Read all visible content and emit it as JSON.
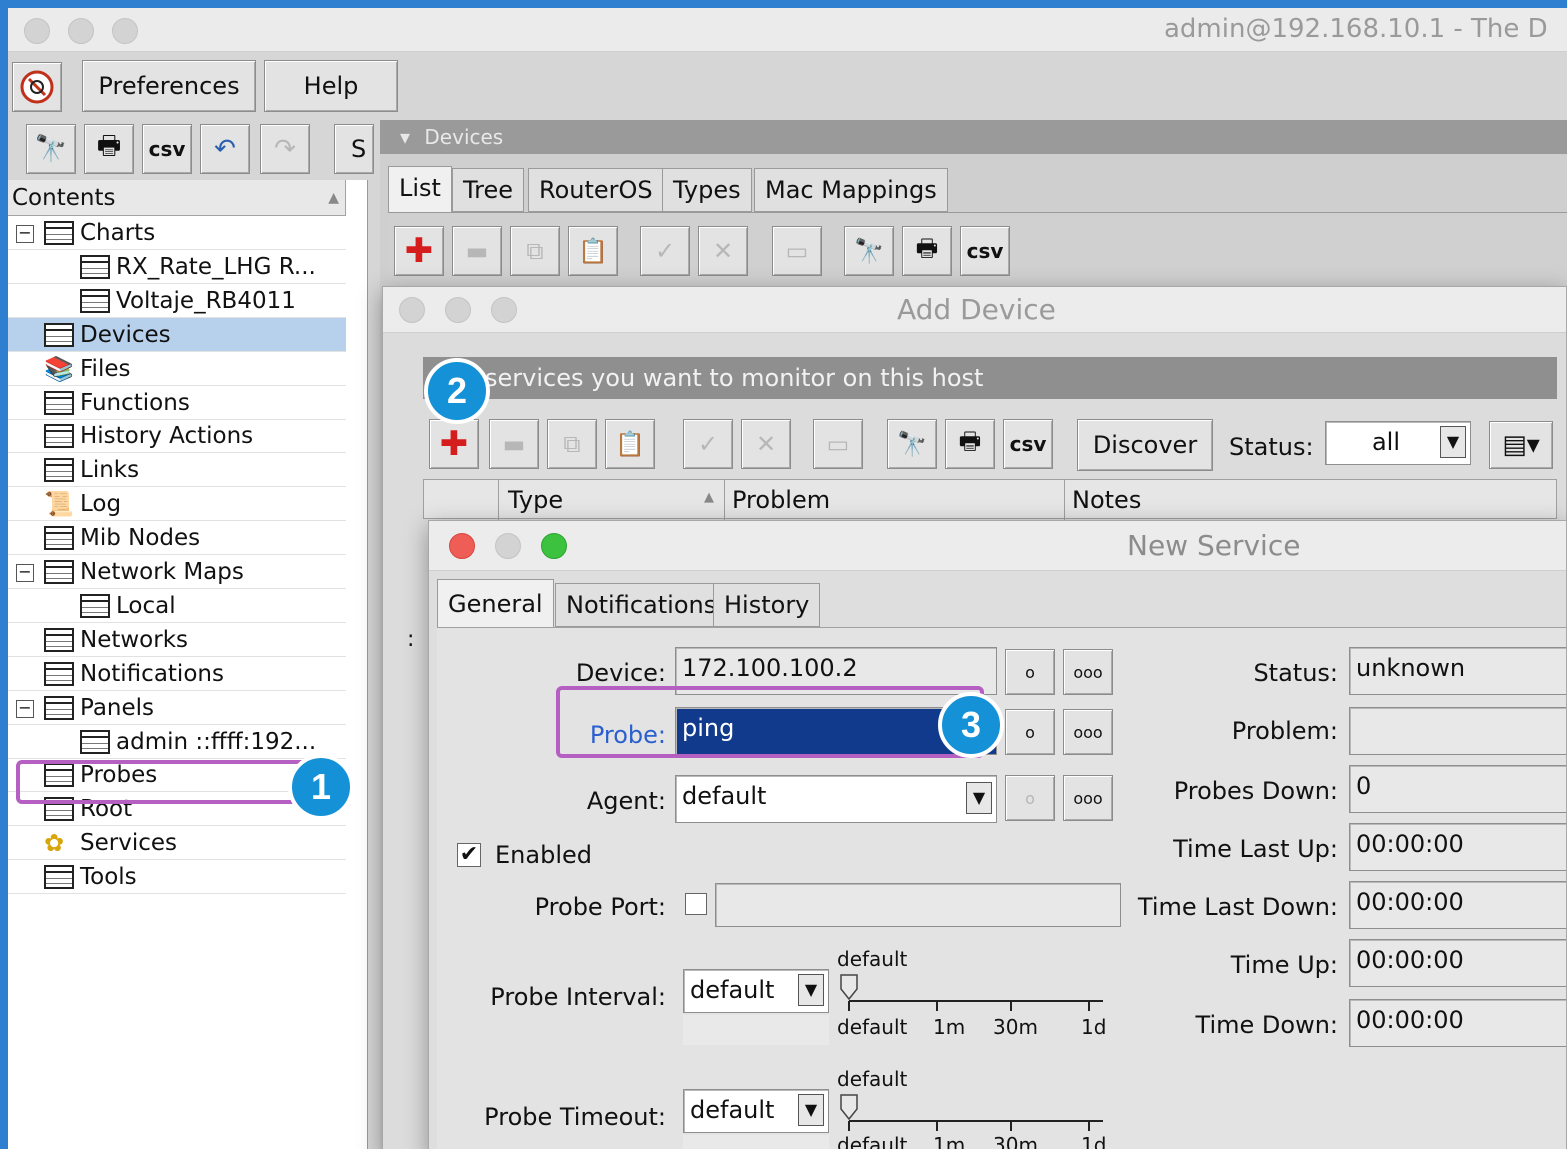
{
  "window": {
    "title": "admin@192.168.10.1 - The D"
  },
  "menu": {
    "preferences": "Preferences",
    "help": "Help"
  },
  "toolbar": {
    "csv": "csv",
    "s_partial": "S"
  },
  "sidebar": {
    "header": "Contents",
    "items": [
      {
        "label": "Charts"
      },
      {
        "label": "RX_Rate_LHG R..."
      },
      {
        "label": "Voltaje_RB4011"
      },
      {
        "label": "Devices"
      },
      {
        "label": "Files"
      },
      {
        "label": "Functions"
      },
      {
        "label": "History Actions"
      },
      {
        "label": "Links"
      },
      {
        "label": "Log"
      },
      {
        "label": "Mib Nodes"
      },
      {
        "label": "Network Maps"
      },
      {
        "label": "Local"
      },
      {
        "label": "Networks"
      },
      {
        "label": "Notifications"
      },
      {
        "label": "Panels"
      },
      {
        "label": "admin ::ffff:192..."
      },
      {
        "label": "Probes"
      },
      {
        "label": "Root"
      },
      {
        "label": "Services"
      },
      {
        "label": "Tools"
      }
    ]
  },
  "devices_panel": {
    "title": "Devices",
    "tabs": [
      "List",
      "Tree",
      "RouterOS",
      "Types",
      "Mac Mappings"
    ],
    "csv": "csv"
  },
  "add_device": {
    "title": "Add Device",
    "banner": "services you want to monitor on this host",
    "discover": "Discover",
    "status_label": "Status:",
    "status_value": "all",
    "csv": "csv",
    "columns": [
      "Type",
      "Problem",
      "Notes"
    ],
    "colon": ":"
  },
  "new_service": {
    "title": "New Service",
    "tabs": [
      "General",
      "Notifications",
      "History"
    ],
    "device_label": "Device:",
    "device_value": "172.100.100.2",
    "probe_label": "Probe:",
    "probe_value": "ping",
    "agent_label": "Agent:",
    "agent_value": "default",
    "enabled_label": "Enabled",
    "probe_port_label": "Probe Port:",
    "probe_interval_label": "Probe Interval:",
    "probe_interval_value": "default",
    "probe_timeout_label": "Probe Timeout:",
    "probe_timeout_value": "default",
    "slider_top": "default",
    "slider_ticks": [
      "default",
      "1m",
      "30m",
      "1d"
    ],
    "status_label": "Status:",
    "status_value": "unknown",
    "problem_label": "Problem:",
    "problem_value": "",
    "probes_down_label": "Probes Down:",
    "probes_down_value": "0",
    "time_last_up_label": "Time Last Up:",
    "time_last_up_value": "00:00:00",
    "time_last_down_label": "Time Last Down:",
    "time_last_down_value": "00:00:00",
    "time_up_label": "Time Up:",
    "time_up_value": "00:00:00",
    "time_down_label": "Time Down:",
    "time_down_value": "00:00:00",
    "dots": "ooo",
    "single": "o"
  },
  "callouts": [
    "1",
    "2",
    "3"
  ],
  "colors": {
    "highlight": "#b65fc3",
    "badge": "#1592d7",
    "selection": "#b7d1ec"
  }
}
